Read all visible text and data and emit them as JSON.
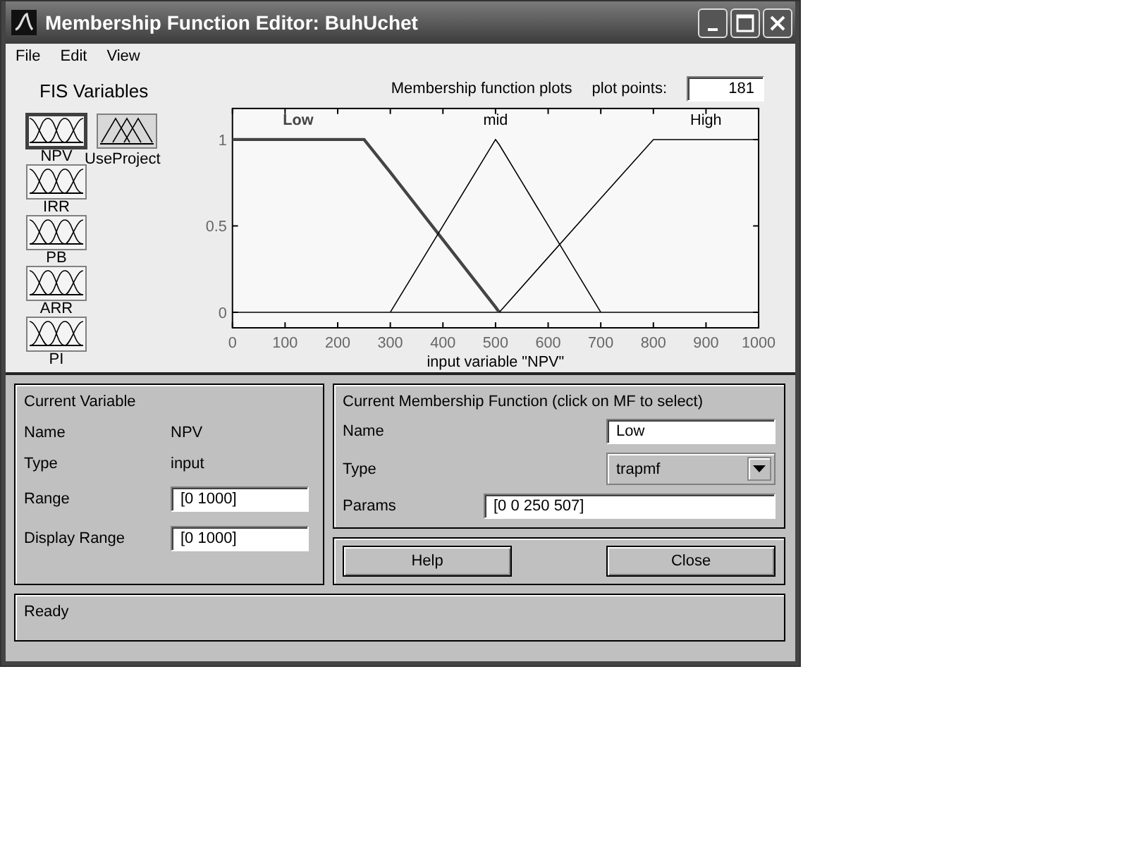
{
  "window": {
    "title": "Membership Function Editor: BuhUchet"
  },
  "menu": [
    "File",
    "Edit",
    "View"
  ],
  "fis_variables": {
    "title": "FIS Variables",
    "inputs": [
      {
        "name": "NPV",
        "selected": true
      },
      {
        "name": "IRR",
        "selected": false
      },
      {
        "name": "PB",
        "selected": false
      },
      {
        "name": "ARR",
        "selected": false
      },
      {
        "name": "PI",
        "selected": false
      }
    ],
    "outputs": [
      {
        "name": "UseProject",
        "selected": false
      }
    ]
  },
  "plot": {
    "title": "Membership function plots",
    "plot_points_label": "plot points:",
    "plot_points": "181",
    "membership_functions": [
      {
        "name": "Low",
        "selected": true
      },
      {
        "name": "mid",
        "selected": false
      },
      {
        "name": "High",
        "selected": false
      }
    ],
    "chart_data": {
      "type": "line",
      "xlabel": "input variable \"NPV\"",
      "x": [
        0,
        250,
        300,
        500,
        507,
        700,
        800,
        1000
      ],
      "series": [
        {
          "values": [
            1,
            1,
            0.81,
            0.03,
            0,
            null,
            null,
            null
          ]
        },
        {
          "values": [
            null,
            null,
            0,
            1,
            0.97,
            0,
            null,
            null
          ]
        },
        {
          "values": [
            null,
            null,
            null,
            null,
            0,
            0.66,
            1,
            1
          ]
        }
      ],
      "xlim": [
        0,
        1000
      ],
      "ylim": [
        -0.09,
        1.18
      ],
      "xticks": [
        0,
        100,
        200,
        300,
        400,
        500,
        600,
        700,
        800,
        900,
        1000
      ],
      "yticks": [
        0,
        0.5,
        1
      ]
    }
  },
  "current_variable": {
    "title": "Current Variable",
    "name_label": "Name",
    "name": "NPV",
    "type_label": "Type",
    "type": "input",
    "range_label": "Range",
    "range": "[0 1000]",
    "display_range_label": "Display Range",
    "display_range": "[0 1000]"
  },
  "current_mf": {
    "title": "Current Membership Function (click on MF to select)",
    "name_label": "Name",
    "name": "Low",
    "type_label": "Type",
    "type": "trapmf",
    "params_label": "Params",
    "params": "[0 0 250 507]"
  },
  "buttons": [
    "Help",
    "Close"
  ],
  "status_bar": "Ready"
}
